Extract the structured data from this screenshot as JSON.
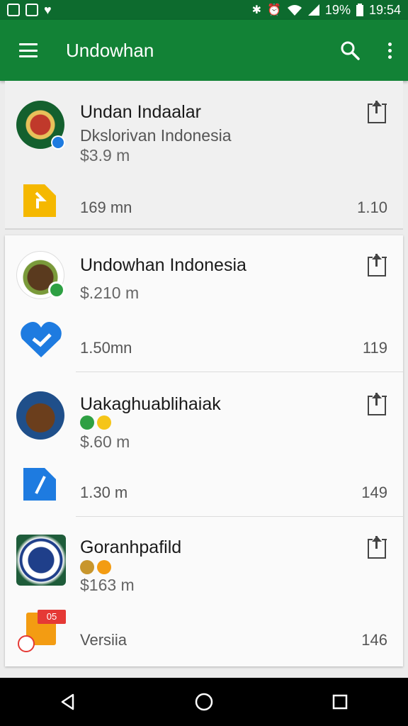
{
  "status_bar": {
    "battery": "19%",
    "time": "19:54"
  },
  "app_bar": {
    "title": "Undowhan"
  },
  "entries": [
    {
      "title": "Undan Indaalar",
      "subtitle": "Dkslorivan Indonesia",
      "amount": "$3.9 m",
      "meta": "169 mn",
      "count": "1.10",
      "avatar_icon": "emblem-icon",
      "small_icon": "download-icon"
    },
    {
      "title": "Undowhan Indonesia",
      "amount": "$.210 m",
      "meta": "1.50mn",
      "count": "119",
      "avatar_icon": "food-icon",
      "small_icon": "heart-icon"
    },
    {
      "title": "Uakaghuablihaiak",
      "amount": "$.60 m",
      "meta": "1.30 m",
      "count": "149",
      "avatar_icon": "food-icon",
      "small_icon": "document-icon"
    },
    {
      "title": "Goranhpafild",
      "amount": "$163 m",
      "meta": "Versiia",
      "count": "146",
      "avatar_icon": "seal-icon",
      "small_icon": "notes-icon",
      "badge": "05"
    }
  ],
  "colors": {
    "status_bar": "#0d6b2e",
    "app_bar": "#128236",
    "accent_yellow": "#f5b800",
    "accent_blue": "#1e7be0"
  }
}
